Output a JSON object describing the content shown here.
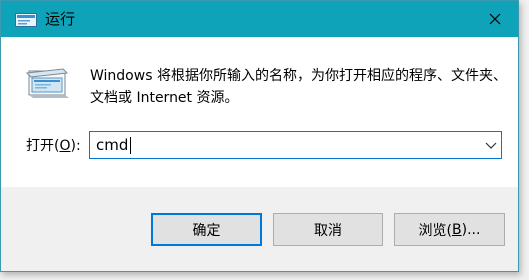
{
  "window": {
    "title": "运行",
    "close_glyph": "✕",
    "accent_color": "#0fa3ba"
  },
  "description": "Windows 将根据你所输入的名称，为你打开相应的程序、文件夹、文档或 Internet 资源。",
  "open_field": {
    "label_prefix": "打开(",
    "label_accel": "O",
    "label_suffix": "):",
    "value": "cmd"
  },
  "buttons": {
    "ok": "确定",
    "cancel": "取消",
    "browse_prefix": "浏览(",
    "browse_accel": "B",
    "browse_suffix": ")..."
  },
  "icons": {
    "title": "run-icon",
    "big": "run-program-icon",
    "close": "close-icon",
    "dropdown": "chevron-down-icon"
  }
}
